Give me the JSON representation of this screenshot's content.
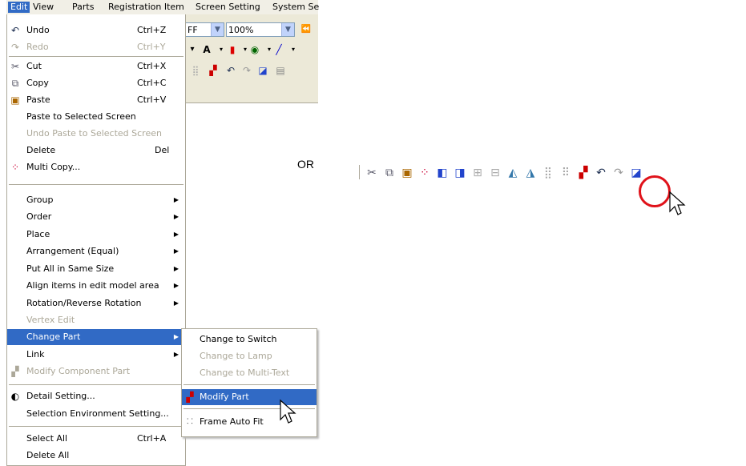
{
  "menubar": {
    "items": [
      "Edit",
      "View",
      "Parts",
      "Registration Item",
      "Screen Setting",
      "System Se"
    ]
  },
  "toolbar": {
    "color_value": "FF",
    "zoom_value": "100%",
    "font_letter": "A"
  },
  "edit_menu": {
    "items": [
      {
        "icon": "undo-icon",
        "label": "Undo",
        "shortcut": "Ctrl+Z"
      },
      {
        "icon": "redo-icon",
        "label": "Redo",
        "shortcut": "Ctrl+Y"
      },
      {
        "icon": "scissors-icon",
        "label": "Cut",
        "shortcut": "Ctrl+X"
      },
      {
        "icon": "copy-icon",
        "label": "Copy",
        "shortcut": "Ctrl+C"
      },
      {
        "icon": "paste-icon",
        "label": "Paste",
        "shortcut": "Ctrl+V"
      },
      {
        "label": "Paste to Selected Screen"
      },
      {
        "label": "Undo Paste to Selected Screen"
      },
      {
        "label": "Delete",
        "shortcut": "Del"
      },
      {
        "icon": "multi-copy-icon",
        "label": "Multi Copy..."
      },
      {
        "label": "Group"
      },
      {
        "label": "Order"
      },
      {
        "label": "Place"
      },
      {
        "label": "Arrangement (Equal)"
      },
      {
        "label": "Put All in Same Size"
      },
      {
        "label": "Align items in edit model area"
      },
      {
        "label": "Rotation/Reverse Rotation"
      },
      {
        "label": "Vertex Edit"
      },
      {
        "label": "Change Part"
      },
      {
        "label": "Link"
      },
      {
        "icon": "modify-component-icon",
        "label": "Modify Component Part"
      },
      {
        "icon": "detail-setting-icon",
        "label": "Detail Setting..."
      },
      {
        "label": "Selection Environment Setting..."
      },
      {
        "label": "Select All",
        "shortcut": "Ctrl+A"
      },
      {
        "label": "Delete All"
      }
    ]
  },
  "change_part_submenu": {
    "items": [
      {
        "label": "Change to Switch"
      },
      {
        "label": "Change to Lamp"
      },
      {
        "label": "Change to Multi-Text"
      },
      {
        "icon": "modify-part-icon",
        "label": "Modify Part"
      },
      {
        "icon": "frame-auto-fit-icon",
        "label": "Frame Auto Fit"
      }
    ]
  },
  "or_label": "OR",
  "colors": {
    "highlight": "#316ac5",
    "disabled": "#aca899",
    "circle": "#e0121a"
  }
}
